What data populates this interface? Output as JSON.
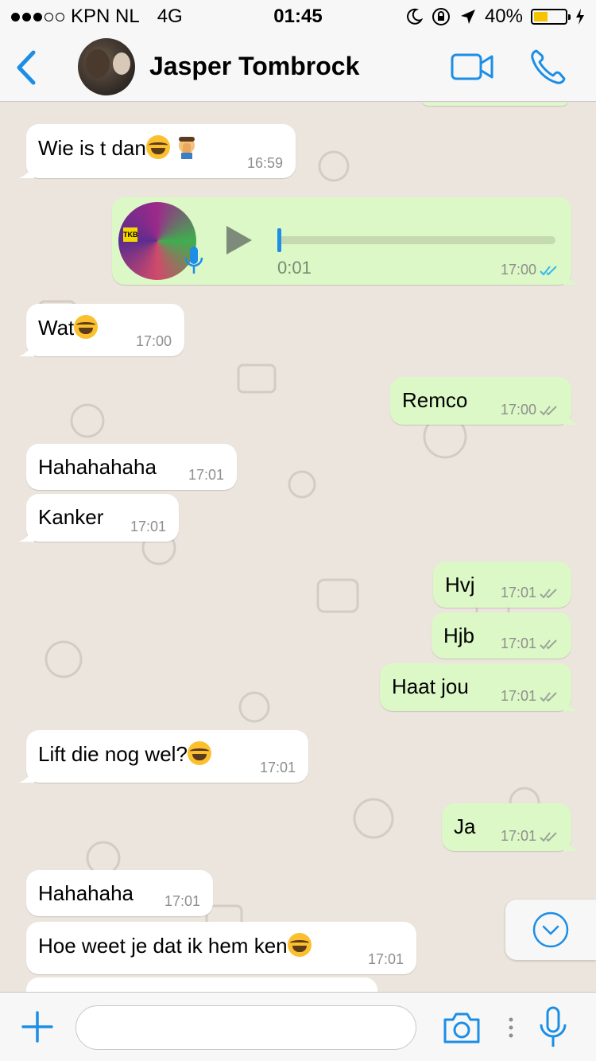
{
  "status": {
    "carrier": "KPN NL",
    "network": "4G",
    "time": "01:45",
    "battery": "40%",
    "battery_level": 0.4
  },
  "header": {
    "contact_name": "Jasper Tombrock"
  },
  "voice": {
    "duration": "0:01",
    "time": "17:00",
    "thumb_badge": "TKB"
  },
  "messages": [
    {
      "text": "Wie is t dan",
      "time": "16:59"
    },
    {
      "text": "Wat",
      "time": "17:00"
    },
    {
      "text": "Remco",
      "time": "17:00"
    },
    {
      "text": "Hahahahaha",
      "time": "17:01"
    },
    {
      "text": "Kanker",
      "time": "17:01"
    },
    {
      "text": "Hvj",
      "time": "17:01"
    },
    {
      "text": "Hjb",
      "time": "17:01"
    },
    {
      "text": "Haat jou",
      "time": "17:01"
    },
    {
      "text": "Lift die nog wel?",
      "time": "17:01"
    },
    {
      "text": "Ja",
      "time": "17:01"
    },
    {
      "text": "Hahahaha",
      "time": "17:01"
    },
    {
      "text": "Hoe weet je dat ik hem ken",
      "time": "17:01"
    }
  ],
  "input": {
    "placeholder": ""
  },
  "colors": {
    "accent": "#1c8ee6",
    "outgoing_bubble": "#dcf8c6",
    "incoming_bubble": "#ffffff",
    "chat_background": "#ece5dd"
  }
}
